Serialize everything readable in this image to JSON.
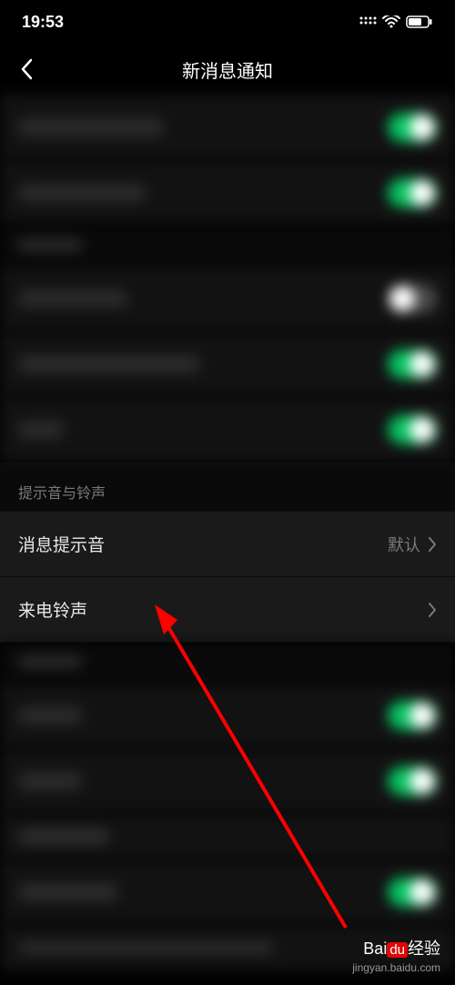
{
  "status_bar": {
    "time": "19:53"
  },
  "nav": {
    "title": "新消息通知"
  },
  "sections": {
    "sound_header": "提示音与铃声",
    "sound_row": {
      "label": "消息提示音",
      "value": "默认"
    },
    "ringtone_row": {
      "label": "来电铃声"
    }
  },
  "watermark": {
    "brand": "Bai",
    "brand_du": "du",
    "brand_suffix": "经验",
    "url": "jingyan.baidu.com"
  }
}
